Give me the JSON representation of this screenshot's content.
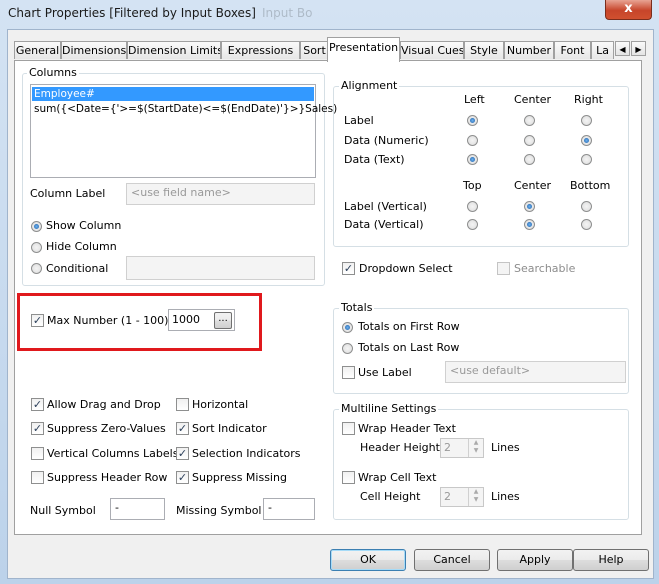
{
  "window": {
    "title": "Chart Properties [Filtered by Input Boxes]",
    "ghost_title": "Input Bo",
    "close_glyph": "x"
  },
  "tabs": [
    {
      "label": "General",
      "active": false
    },
    {
      "label": "Dimensions",
      "active": false
    },
    {
      "label": "Dimension Limits",
      "active": false
    },
    {
      "label": "Expressions",
      "active": false
    },
    {
      "label": "Sort",
      "active": false
    },
    {
      "label": "Presentation",
      "active": true
    },
    {
      "label": "Visual Cues",
      "active": false
    },
    {
      "label": "Style",
      "active": false
    },
    {
      "label": "Number",
      "active": false
    },
    {
      "label": "Font",
      "active": false
    },
    {
      "label": "La",
      "active": false
    }
  ],
  "tab_scroll": {
    "left": "◀",
    "right": "▶"
  },
  "columns": {
    "label": "Columns",
    "items": [
      "Employee#",
      "sum({<Date={'>=$(StartDate)<=$(EndDate)'}>}Sales)"
    ],
    "selected_index": 0,
    "column_label": "Column Label",
    "column_label_placeholder": "<use field name>",
    "show_column": "Show Column",
    "hide_column": "Hide Column",
    "conditional": "Conditional",
    "selected_radio": "show_column"
  },
  "alignment": {
    "label": "Alignment",
    "horiz_headers": [
      "Left",
      "Center",
      "Right"
    ],
    "vert_headers": [
      "Top",
      "Center",
      "Bottom"
    ],
    "rows_h": [
      {
        "label": "Label",
        "selected": 0
      },
      {
        "label": "Data (Numeric)",
        "selected": 2
      },
      {
        "label": "Data (Text)",
        "selected": 0
      }
    ],
    "rows_v": [
      {
        "label": "Label (Vertical)",
        "selected": 1
      },
      {
        "label": "Data (Vertical)",
        "selected": 1
      }
    ]
  },
  "dropdown_select": {
    "label": "Dropdown Select",
    "checked": true
  },
  "searchable": {
    "label": "Searchable",
    "checked": false,
    "disabled": true
  },
  "max_number": {
    "label": "Max Number (1 - 100)",
    "checked": true,
    "value": "1000",
    "browse": "..."
  },
  "totals": {
    "label": "Totals",
    "first_row": "Totals on First Row",
    "last_row": "Totals on Last Row",
    "selected": "first_row",
    "use_label": "Use Label",
    "use_label_checked": false,
    "use_label_placeholder": "<use default>"
  },
  "options": [
    {
      "key": "allow_drag",
      "label": "Allow Drag and Drop",
      "checked": true
    },
    {
      "key": "horizontal",
      "label": "Horizontal",
      "checked": false
    },
    {
      "key": "suppress_zero",
      "label": "Suppress Zero-Values",
      "checked": true
    },
    {
      "key": "sort_indicator",
      "label": "Sort Indicator",
      "checked": true
    },
    {
      "key": "vertical_labels",
      "label": "Vertical Columns Labels",
      "checked": false
    },
    {
      "key": "selection_indicators",
      "label": "Selection Indicators",
      "checked": true
    },
    {
      "key": "suppress_header",
      "label": "Suppress Header Row",
      "checked": false
    },
    {
      "key": "suppress_missing",
      "label": "Suppress Missing",
      "checked": true
    }
  ],
  "null_symbol": {
    "label": "Null Symbol",
    "value": "-"
  },
  "missing_symbol": {
    "label": "Missing Symbol",
    "value": "-"
  },
  "multiline": {
    "label": "Multiline Settings",
    "wrap_header": "Wrap Header Text",
    "wrap_header_checked": false,
    "header_height": "Header Height",
    "header_height_value": "2",
    "wrap_cell": "Wrap Cell Text",
    "wrap_cell_checked": false,
    "cell_height": "Cell Height",
    "cell_height_value": "2",
    "lines": "Lines"
  },
  "buttons": {
    "ok": "OK",
    "cancel": "Cancel",
    "apply": "Apply",
    "help": "Help"
  },
  "check_glyph": "✓",
  "spin_up": "▲",
  "spin_down": "▼",
  "colors": {
    "highlight": "#3399ff",
    "annotation_red": "#e0191d",
    "close": "#c7452a"
  }
}
